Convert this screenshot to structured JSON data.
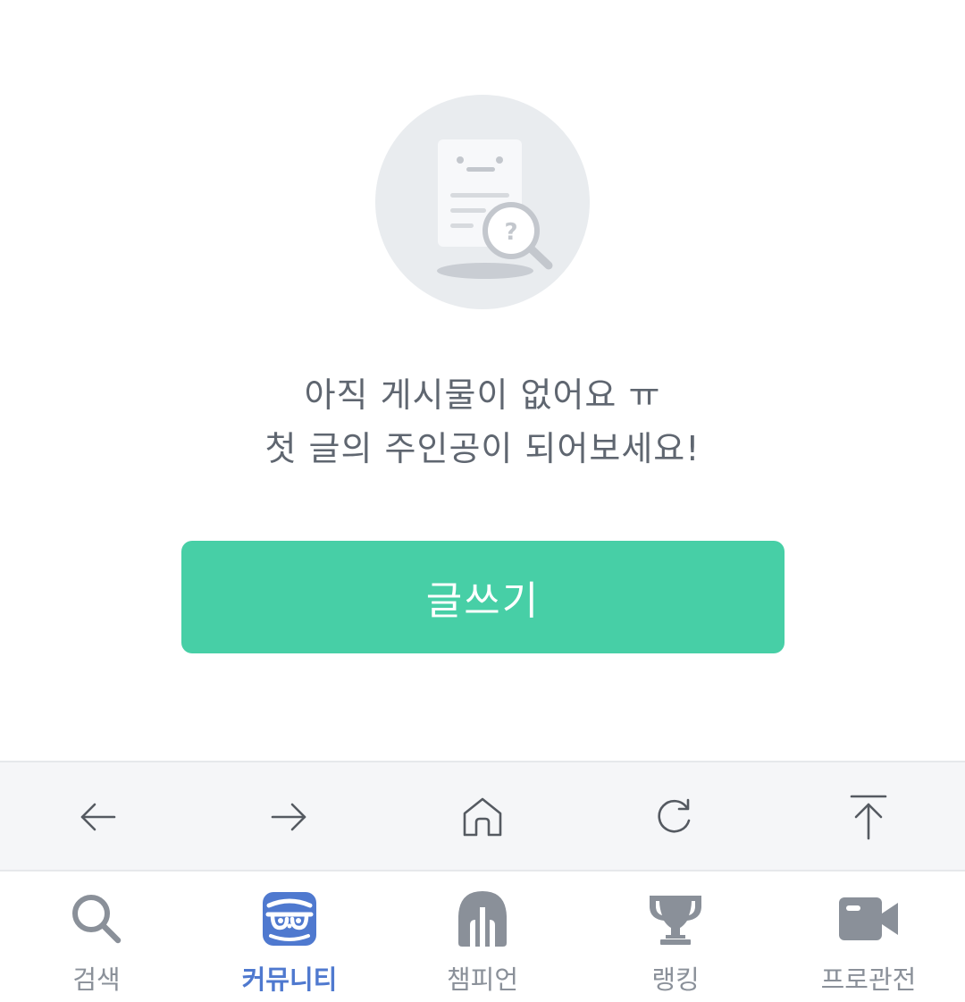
{
  "empty_state": {
    "line1": "아직 게시물이 없어요 ㅠ",
    "line2": "첫 글의 주인공이 되어보세요!",
    "illustration_icon": "document-search-icon"
  },
  "write_button": {
    "label": "글쓰기",
    "color": "#47cfa6"
  },
  "browser_toolbar": {
    "items": [
      {
        "name": "back",
        "icon": "arrow-left-icon"
      },
      {
        "name": "forward",
        "icon": "arrow-right-icon"
      },
      {
        "name": "home",
        "icon": "home-icon"
      },
      {
        "name": "reload",
        "icon": "reload-icon"
      },
      {
        "name": "scroll-top",
        "icon": "scroll-top-icon"
      }
    ]
  },
  "bottom_nav": {
    "active_color": "#4f79cf",
    "inactive_color": "#8a9099",
    "items": [
      {
        "label": "검색",
        "icon": "search-icon",
        "active": false
      },
      {
        "label": "커뮤니티",
        "icon": "community-icon",
        "active": true
      },
      {
        "label": "챔피언",
        "icon": "champion-helmet-icon",
        "active": false
      },
      {
        "label": "랭킹",
        "icon": "trophy-icon",
        "active": false
      },
      {
        "label": "프로관전",
        "icon": "video-camera-icon",
        "active": false
      }
    ]
  }
}
